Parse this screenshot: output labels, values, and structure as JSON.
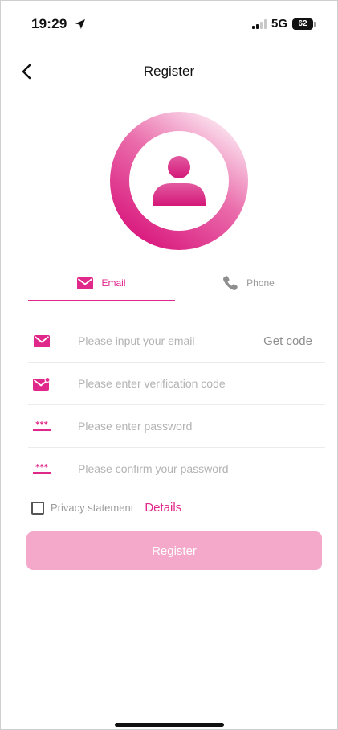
{
  "status_bar": {
    "time": "19:29",
    "network": "5G",
    "battery": "62"
  },
  "nav": {
    "title": "Register"
  },
  "tabs": [
    {
      "label": "Email",
      "icon": "envelope-icon",
      "active": true
    },
    {
      "label": "Phone",
      "icon": "phone-icon",
      "active": false
    }
  ],
  "form": {
    "email_placeholder": "Please input your email",
    "get_code_label": "Get code",
    "code_placeholder": "Please enter verification code",
    "password_placeholder": "Please enter password",
    "confirm_placeholder": "Please confirm your password"
  },
  "privacy": {
    "label": "Privacy statement",
    "details": "Details",
    "checked": false
  },
  "register_label": "Register",
  "colors": {
    "accent": "#e0278a",
    "button_disabled": "#f4a9cb"
  }
}
